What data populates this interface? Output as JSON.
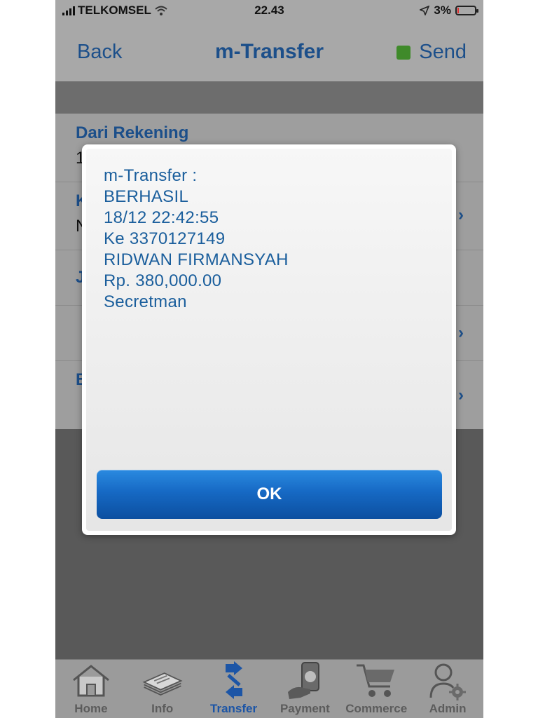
{
  "status_bar": {
    "carrier": "TELKOMSEL",
    "time": "22.43",
    "battery": "3%"
  },
  "nav": {
    "back_label": "Back",
    "title": "m-Transfer",
    "send_label": "Send"
  },
  "form": {
    "rows": [
      {
        "label": "Dari Rekening",
        "value": "1"
      },
      {
        "label": "K",
        "value": "N"
      },
      {
        "label": "J"
      },
      {
        "label": ""
      },
      {
        "label": "B"
      }
    ]
  },
  "dialog": {
    "lines": [
      "m-Transfer :",
      "BERHASIL",
      "18/12 22:42:55",
      "Ke 3370127149",
      "RIDWAN FIRMANSYAH",
      "Rp. 380,000.00",
      "Secretman"
    ],
    "ok_label": "OK"
  },
  "tabbar": {
    "tabs": [
      {
        "label": "Home",
        "icon": "home-icon"
      },
      {
        "label": "Info",
        "icon": "info-icon"
      },
      {
        "label": "Transfer",
        "icon": "transfer-icon",
        "active": true
      },
      {
        "label": "Payment",
        "icon": "payment-icon"
      },
      {
        "label": "Commerce",
        "icon": "cart-icon"
      },
      {
        "label": "Admin",
        "icon": "admin-icon"
      }
    ]
  },
  "colors": {
    "accent": "#1c4f8a",
    "active_tab": "#1c55a6",
    "ok_button": "#1669c4",
    "dialog_text": "#1a5e9c"
  }
}
